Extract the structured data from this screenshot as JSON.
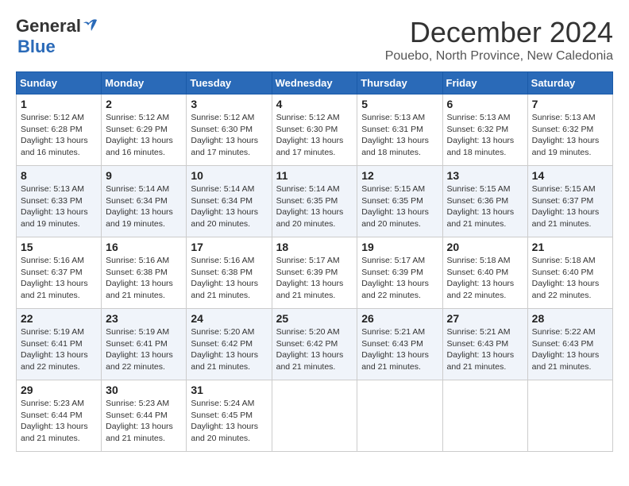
{
  "logo": {
    "line1": "General",
    "line2": "Blue",
    "bird_unicode": "🐦"
  },
  "title": "December 2024",
  "location": "Pouebo, North Province, New Caledonia",
  "header": {
    "days": [
      "Sunday",
      "Monday",
      "Tuesday",
      "Wednesday",
      "Thursday",
      "Friday",
      "Saturday"
    ]
  },
  "weeks": [
    [
      {
        "day": 1,
        "sunrise": "5:12 AM",
        "sunset": "6:28 PM",
        "daylight": "13 hours and 16 minutes."
      },
      {
        "day": 2,
        "sunrise": "5:12 AM",
        "sunset": "6:29 PM",
        "daylight": "13 hours and 16 minutes."
      },
      {
        "day": 3,
        "sunrise": "5:12 AM",
        "sunset": "6:30 PM",
        "daylight": "13 hours and 17 minutes."
      },
      {
        "day": 4,
        "sunrise": "5:12 AM",
        "sunset": "6:30 PM",
        "daylight": "13 hours and 17 minutes."
      },
      {
        "day": 5,
        "sunrise": "5:13 AM",
        "sunset": "6:31 PM",
        "daylight": "13 hours and 18 minutes."
      },
      {
        "day": 6,
        "sunrise": "5:13 AM",
        "sunset": "6:32 PM",
        "daylight": "13 hours and 18 minutes."
      },
      {
        "day": 7,
        "sunrise": "5:13 AM",
        "sunset": "6:32 PM",
        "daylight": "13 hours and 19 minutes."
      }
    ],
    [
      {
        "day": 8,
        "sunrise": "5:13 AM",
        "sunset": "6:33 PM",
        "daylight": "13 hours and 19 minutes."
      },
      {
        "day": 9,
        "sunrise": "5:14 AM",
        "sunset": "6:34 PM",
        "daylight": "13 hours and 19 minutes."
      },
      {
        "day": 10,
        "sunrise": "5:14 AM",
        "sunset": "6:34 PM",
        "daylight": "13 hours and 20 minutes."
      },
      {
        "day": 11,
        "sunrise": "5:14 AM",
        "sunset": "6:35 PM",
        "daylight": "13 hours and 20 minutes."
      },
      {
        "day": 12,
        "sunrise": "5:15 AM",
        "sunset": "6:35 PM",
        "daylight": "13 hours and 20 minutes."
      },
      {
        "day": 13,
        "sunrise": "5:15 AM",
        "sunset": "6:36 PM",
        "daylight": "13 hours and 21 minutes."
      },
      {
        "day": 14,
        "sunrise": "5:15 AM",
        "sunset": "6:37 PM",
        "daylight": "13 hours and 21 minutes."
      }
    ],
    [
      {
        "day": 15,
        "sunrise": "5:16 AM",
        "sunset": "6:37 PM",
        "daylight": "13 hours and 21 minutes."
      },
      {
        "day": 16,
        "sunrise": "5:16 AM",
        "sunset": "6:38 PM",
        "daylight": "13 hours and 21 minutes."
      },
      {
        "day": 17,
        "sunrise": "5:16 AM",
        "sunset": "6:38 PM",
        "daylight": "13 hours and 21 minutes."
      },
      {
        "day": 18,
        "sunrise": "5:17 AM",
        "sunset": "6:39 PM",
        "daylight": "13 hours and 21 minutes."
      },
      {
        "day": 19,
        "sunrise": "5:17 AM",
        "sunset": "6:39 PM",
        "daylight": "13 hours and 22 minutes."
      },
      {
        "day": 20,
        "sunrise": "5:18 AM",
        "sunset": "6:40 PM",
        "daylight": "13 hours and 22 minutes."
      },
      {
        "day": 21,
        "sunrise": "5:18 AM",
        "sunset": "6:40 PM",
        "daylight": "13 hours and 22 minutes."
      }
    ],
    [
      {
        "day": 22,
        "sunrise": "5:19 AM",
        "sunset": "6:41 PM",
        "daylight": "13 hours and 22 minutes."
      },
      {
        "day": 23,
        "sunrise": "5:19 AM",
        "sunset": "6:41 PM",
        "daylight": "13 hours and 22 minutes."
      },
      {
        "day": 24,
        "sunrise": "5:20 AM",
        "sunset": "6:42 PM",
        "daylight": "13 hours and 21 minutes."
      },
      {
        "day": 25,
        "sunrise": "5:20 AM",
        "sunset": "6:42 PM",
        "daylight": "13 hours and 21 minutes."
      },
      {
        "day": 26,
        "sunrise": "5:21 AM",
        "sunset": "6:43 PM",
        "daylight": "13 hours and 21 minutes."
      },
      {
        "day": 27,
        "sunrise": "5:21 AM",
        "sunset": "6:43 PM",
        "daylight": "13 hours and 21 minutes."
      },
      {
        "day": 28,
        "sunrise": "5:22 AM",
        "sunset": "6:43 PM",
        "daylight": "13 hours and 21 minutes."
      }
    ],
    [
      {
        "day": 29,
        "sunrise": "5:23 AM",
        "sunset": "6:44 PM",
        "daylight": "13 hours and 21 minutes."
      },
      {
        "day": 30,
        "sunrise": "5:23 AM",
        "sunset": "6:44 PM",
        "daylight": "13 hours and 21 minutes."
      },
      {
        "day": 31,
        "sunrise": "5:24 AM",
        "sunset": "6:45 PM",
        "daylight": "13 hours and 20 minutes."
      },
      null,
      null,
      null,
      null
    ]
  ],
  "labels": {
    "sunrise": "Sunrise:",
    "sunset": "Sunset:",
    "daylight": "Daylight:"
  }
}
